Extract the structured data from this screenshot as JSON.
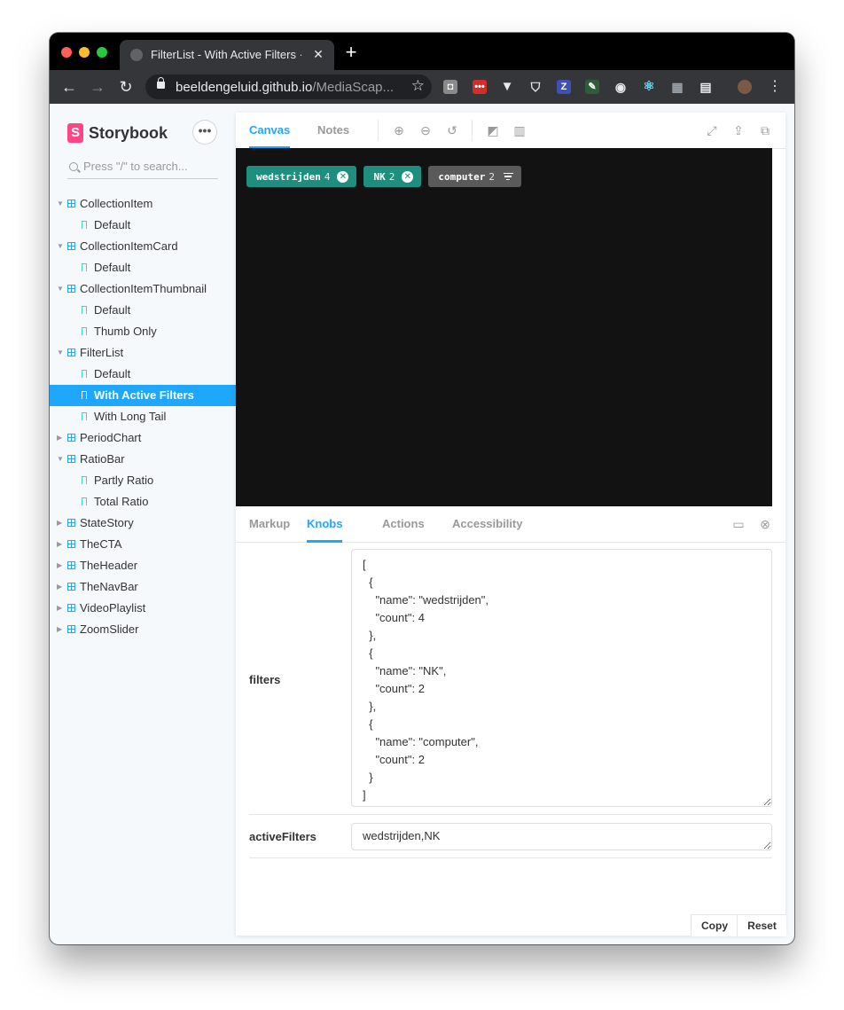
{
  "browser": {
    "tab_title": "FilterList - With Active Filters ·",
    "url_host": "beeldengeluid.github.io",
    "url_path": "/MediaScap..."
  },
  "sidebar": {
    "brand": "Storybook",
    "brand_mark": "S",
    "search_placeholder": "Press \"/\" to search...",
    "items": [
      {
        "label": "CollectionItem",
        "type": "group",
        "expanded": true
      },
      {
        "label": "Default",
        "type": "story"
      },
      {
        "label": "CollectionItemCard",
        "type": "group",
        "expanded": true
      },
      {
        "label": "Default",
        "type": "story"
      },
      {
        "label": "CollectionItemThumbnail",
        "type": "group",
        "expanded": true
      },
      {
        "label": "Default",
        "type": "story"
      },
      {
        "label": "Thumb Only",
        "type": "story"
      },
      {
        "label": "FilterList",
        "type": "group",
        "expanded": true
      },
      {
        "label": "Default",
        "type": "story"
      },
      {
        "label": "With Active Filters",
        "type": "story",
        "active": true
      },
      {
        "label": "With Long Tail",
        "type": "story"
      },
      {
        "label": "PeriodChart",
        "type": "group",
        "expanded": false
      },
      {
        "label": "RatioBar",
        "type": "group",
        "expanded": true
      },
      {
        "label": "Partly Ratio",
        "type": "story"
      },
      {
        "label": "Total Ratio",
        "type": "story"
      },
      {
        "label": "StateStory",
        "type": "group",
        "expanded": false
      },
      {
        "label": "TheCTA",
        "type": "group",
        "expanded": false
      },
      {
        "label": "TheHeader",
        "type": "group",
        "expanded": false
      },
      {
        "label": "TheNavBar",
        "type": "group",
        "expanded": false
      },
      {
        "label": "VideoPlaylist",
        "type": "group",
        "expanded": false
      },
      {
        "label": "ZoomSlider",
        "type": "group",
        "expanded": false
      }
    ]
  },
  "toolbar": {
    "tab_canvas": "Canvas",
    "tab_notes": "Notes"
  },
  "canvas": {
    "filters": [
      {
        "name": "wedstrijden",
        "count": "4",
        "active": true,
        "color": "#1e8f7f"
      },
      {
        "name": "NK",
        "count": "2",
        "active": true,
        "color": "#1e8f7f"
      },
      {
        "name": "computer",
        "count": "2",
        "active": false,
        "color": "#5a5a5a"
      }
    ]
  },
  "addons": {
    "tabs": [
      "Markup",
      "Knobs",
      "Actions",
      "Accessibility"
    ],
    "active_tab": "Knobs",
    "filters_label": "filters",
    "filters_value": "[\n  {\n    \"name\": \"wedstrijden\",\n    \"count\": 4\n  },\n  {\n    \"name\": \"NK\",\n    \"count\": 2\n  },\n  {\n    \"name\": \"computer\",\n    \"count\": 2\n  }\n]",
    "active_label": "activeFilters",
    "active_value": "wedstrijden,NK",
    "copy": "Copy",
    "reset": "Reset"
  },
  "colors": {
    "accent": "#1ea7fd",
    "brand": "#ff4785",
    "filter_active": "#1e8f7f",
    "filter_inactive": "#5a5a5a"
  }
}
